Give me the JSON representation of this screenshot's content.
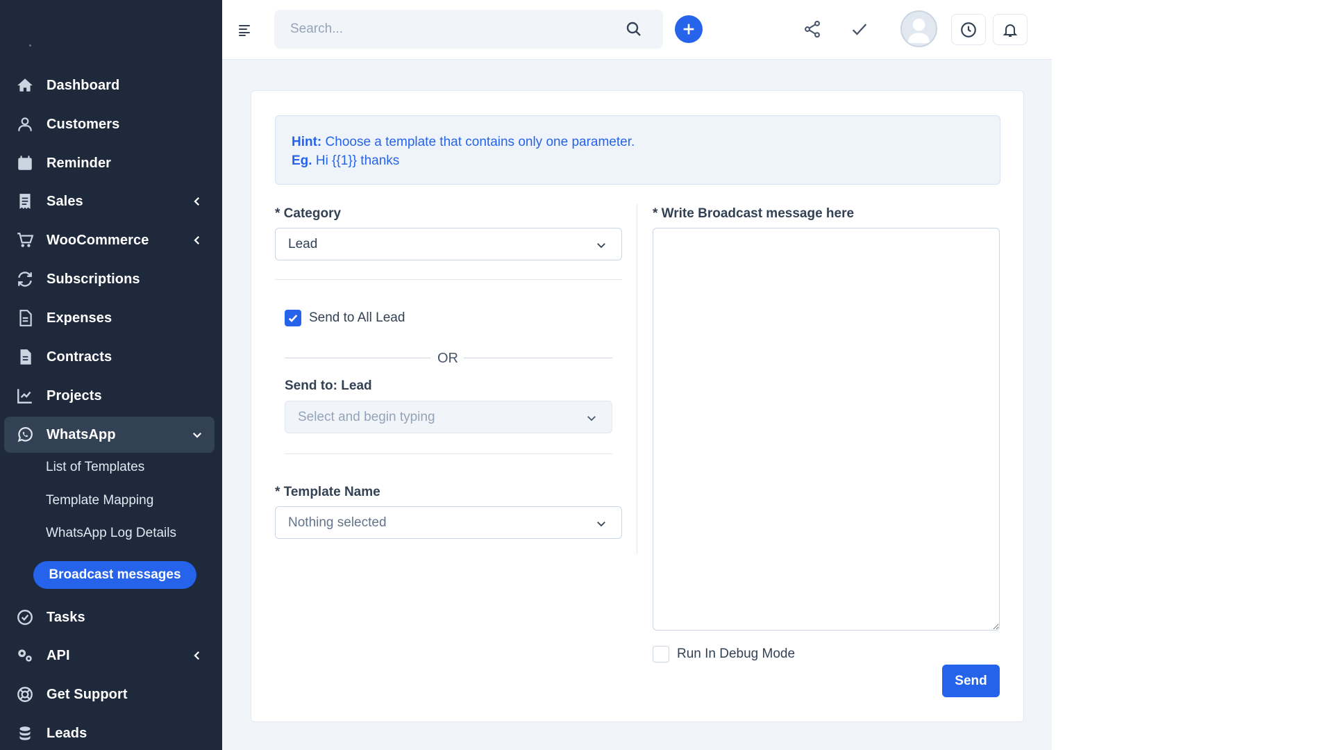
{
  "sidebar": {
    "items": [
      {
        "label": "Dashboard",
        "icon": "home-icon"
      },
      {
        "label": "Customers",
        "icon": "user-icon"
      },
      {
        "label": "Reminder",
        "icon": "calendar-icon"
      },
      {
        "label": "Sales",
        "icon": "receipt-icon"
      },
      {
        "label": "WooCommerce",
        "icon": "cart-icon"
      },
      {
        "label": "Subscriptions",
        "icon": "refresh-icon"
      },
      {
        "label": "Expenses",
        "icon": "file-icon"
      },
      {
        "label": "Contracts",
        "icon": "contract-icon"
      },
      {
        "label": "Projects",
        "icon": "chart-icon"
      },
      {
        "label": "WhatsApp",
        "icon": "whatsapp-icon"
      },
      {
        "label": "Tasks",
        "icon": "check-circle-icon"
      },
      {
        "label": "API",
        "icon": "cogs-icon"
      },
      {
        "label": "Get Support",
        "icon": "life-ring-icon"
      },
      {
        "label": "Leads",
        "icon": "leads-icon"
      }
    ],
    "whatsapp_sub": [
      "List of Templates",
      "Template Mapping",
      "WhatsApp Log Details"
    ],
    "active_sub": "Broadcast messages"
  },
  "topbar": {
    "search_placeholder": "Search..."
  },
  "hint": {
    "label": "Hint:",
    "text": " Choose a template that contains only one parameter.",
    "eg_label": "Eg.",
    "eg_text": " Hi {{1}} thanks"
  },
  "form": {
    "category_label": "* Category",
    "category_value": "Lead",
    "send_all_label": "Send to All Lead",
    "send_all_checked": true,
    "or_text": "OR",
    "send_to_label": "Send to: Lead",
    "send_to_placeholder": "Select and begin typing",
    "template_label": "* Template Name",
    "template_placeholder": "Nothing selected",
    "message_label": "* Write Broadcast message here",
    "debug_label": "Run In Debug Mode",
    "debug_checked": false,
    "send_label": "Send"
  },
  "colors": {
    "sidebar_bg": "#1e293b",
    "accent": "#2563eb",
    "content_bg": "#f1f5f9"
  }
}
